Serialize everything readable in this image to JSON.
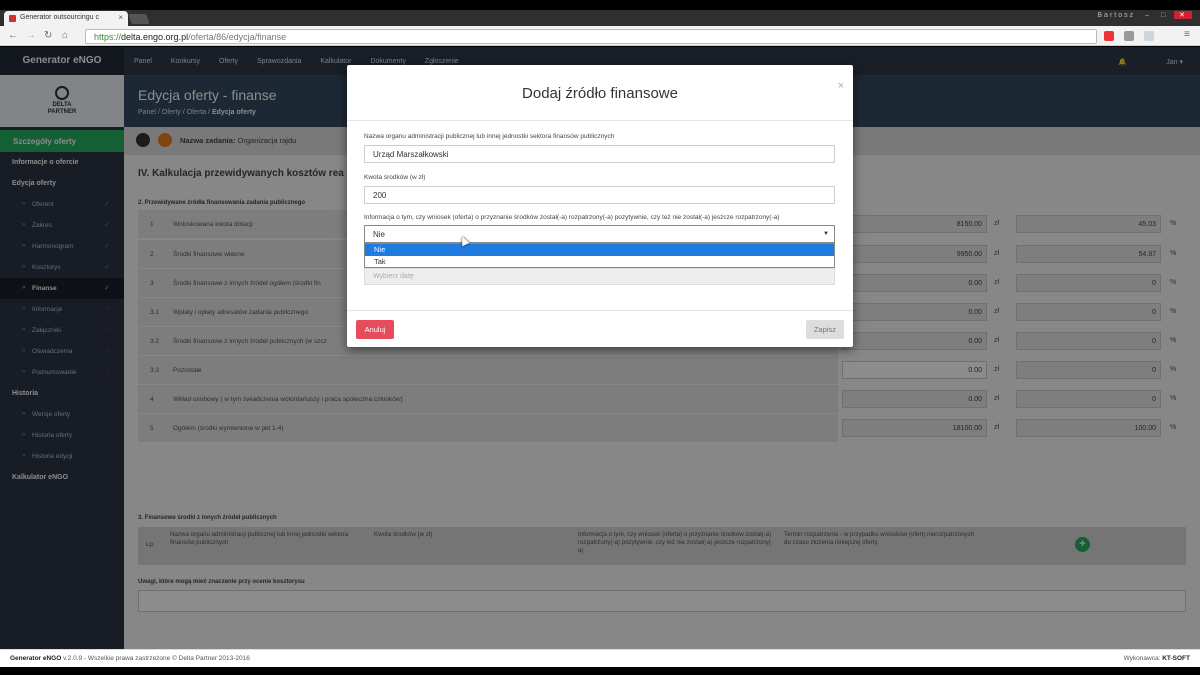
{
  "browser": {
    "tab_title": "Generator outsourcingu c",
    "tab_close": "×",
    "window_user": "Bartosz",
    "win_min": "–",
    "win_max": "□",
    "win_close": "✕",
    "url_scheme": "https://",
    "url_host": "delta.engo.org.pl",
    "url_path": "/oferta/86/edycja/finanse"
  },
  "brand": "Generator eNGO",
  "logo_text": [
    "DELTA",
    "PARTNER"
  ],
  "sidebar": {
    "section": "Szczegóły oferty",
    "items": [
      {
        "label": "Informacje o ofercie",
        "type": "h"
      },
      {
        "label": "Edycja oferty",
        "type": "h"
      },
      {
        "label": "Oferent",
        "type": "sub",
        "status": "✓"
      },
      {
        "label": "Zakres",
        "type": "sub",
        "status": "✓"
      },
      {
        "label": "Harmonogram",
        "type": "sub",
        "status": "✓"
      },
      {
        "label": "Kosztorys",
        "type": "sub",
        "status": "✓"
      },
      {
        "label": "Finanse",
        "type": "sub",
        "status": "✓",
        "active": true
      },
      {
        "label": "Informacje",
        "type": "sub",
        "status": "○"
      },
      {
        "label": "Załączniki",
        "type": "sub",
        "status": "○"
      },
      {
        "label": "Oświadczenia",
        "type": "sub",
        "status": "○"
      },
      {
        "label": "Podsumowanie",
        "type": "sub",
        "status": "○"
      },
      {
        "label": "Historia",
        "type": "h"
      },
      {
        "label": "Wersje oferty",
        "type": "sub"
      },
      {
        "label": "Historia oferty",
        "type": "sub"
      },
      {
        "label": "Historia edycji",
        "type": "sub"
      },
      {
        "label": "Kalkulator eNGO",
        "type": "h"
      }
    ]
  },
  "topnav": {
    "items": [
      "Panel",
      "Konkursy",
      "Oferty",
      "Sprawozdania",
      "Kalkulator",
      "Dokumenty",
      "Zgłoszenie"
    ],
    "user": "Jan ▾",
    "bell": "🔔"
  },
  "page": {
    "title": "Edycja oferty - finanse",
    "crumbs": [
      "Panel",
      "Oferty",
      "Oferta"
    ],
    "crumb_active": "Edycja oferty",
    "task_label": "Nazwa zadania:",
    "task_value": "Organizacja rajdu"
  },
  "section": {
    "title": "IV. Kalkulacja przewidywanych kosztów rea",
    "subtitle": "2. Przewidywane źródła finansowania zadania publicznego",
    "rows": [
      {
        "n": "1",
        "label": "Wnioskowana kwota dotacji",
        "amount": "8150.00",
        "pct": "45.03"
      },
      {
        "n": "2",
        "label": "Środki finansowe własne",
        "amount": "9950.00",
        "pct": "54.97"
      },
      {
        "n": "3",
        "label": "Środki finansowe z innych źródeł ogółem (środki fin",
        "amount": "0.00",
        "pct": "0"
      },
      {
        "n": "3.1",
        "label": "Wpłaty i opłaty adresatów zadania publicznego",
        "amount": "0.00",
        "pct": "0"
      },
      {
        "n": "3.2",
        "label": "Środki finansowe z innych źródeł publicznych (w szcz",
        "amount": "0.00",
        "pct": "0"
      },
      {
        "n": "3.3",
        "label": "Pozostałe",
        "amount": "0.00",
        "pct": "0"
      },
      {
        "n": "4",
        "label": "Wkład osobowy ( w tym świadczenia wolontariuszy i praca społeczna członków)",
        "amount": "0.00",
        "pct": "0"
      },
      {
        "n": "5",
        "label": "Ogółem (środki wymienione w pkt 1-4)",
        "amount": "18100.00",
        "pct": "100.00"
      }
    ],
    "unit_amount": "zł",
    "unit_pct": "%"
  },
  "table3": {
    "title": "3. Finansowe środki z innych źródeł publicznych",
    "headers": [
      "Lp.",
      "Nazwa organu administracji publicznej lub innej jednostki sektora finansów publicznych",
      "Kwota środków (w zł)",
      "Informacja o tym, czy wniosek (oferta) o przyznanie środków został(-a) rozpatrzony(-a) pozytywnie, czy też nie został(-a) jeszcze rozpatrzony(-a)",
      "Termin rozpatrzenia - w przypadku wniosków (ofert) nierozpatrzonych do czasu złożenia niniejszej oferty"
    ],
    "add": "+"
  },
  "remarks_label": "Uwagi, które mogą mieć znaczenie przy ocenie kosztorysu",
  "footer": {
    "app": "Generator eNGO",
    "rest": " v.2.0.9 - Wszelkie prawa zastrzeżone © Delta Partner 2013-2016",
    "exec_label": "Wykonawca: ",
    "exec": "KT-SOFT"
  },
  "modal": {
    "title": "Dodaj źródło finansowe",
    "close": "×",
    "field1_label": "Nazwa organu administracji publicznej lub innej jednostki sektora finansów publicznych",
    "field1_value": "Urząd Marszałkowski",
    "field2_label": "Kwota środków (w zł)",
    "field2_value": "200",
    "field3_label": "Informacja o tym, czy wniosek (oferta) o przyznanie środków został(-a) rozpatrzony(-a) pozytywnie, czy też nie został(-a) jeszcze rozpatrzony(-a)",
    "field3_value": "Nie",
    "options": [
      "Nie",
      "Tak"
    ],
    "date_placeholder": "Wybierz datę",
    "cancel": "Anuluj",
    "save": "Zapisz"
  }
}
